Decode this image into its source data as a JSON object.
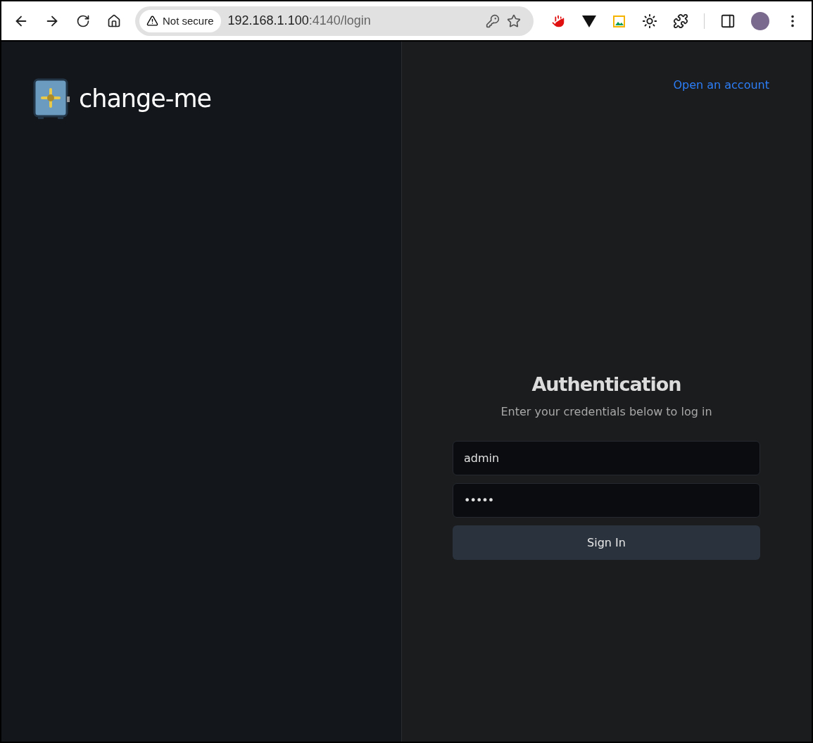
{
  "browser": {
    "security_label": "Not secure",
    "url_host": "192.168.1.100",
    "url_path": ":4140/login"
  },
  "brand": {
    "name": "change-me"
  },
  "header": {
    "link": "Open an account"
  },
  "login": {
    "title": "Authentication",
    "subtitle": "Enter your credentials below to log in",
    "fields": [
      {
        "kind": "username",
        "value": "admin"
      },
      {
        "kind": "password",
        "value": "•••••"
      }
    ],
    "button": "Sign In"
  }
}
